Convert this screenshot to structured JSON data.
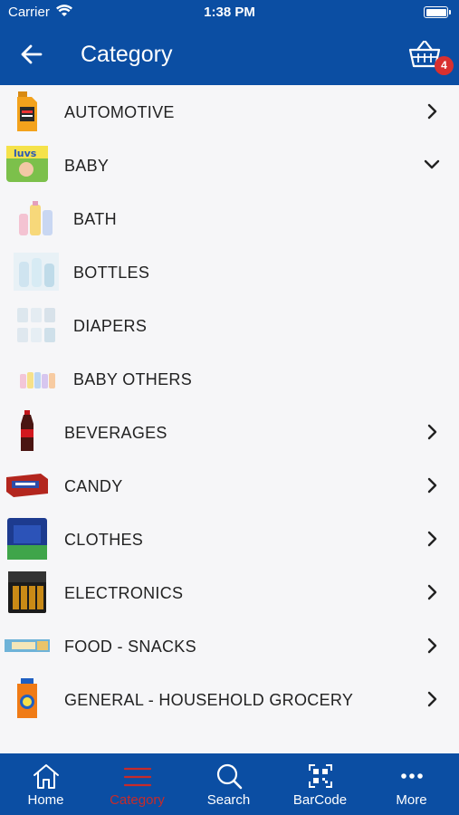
{
  "status": {
    "carrier": "Carrier",
    "time": "1:38 PM"
  },
  "header": {
    "title": "Category",
    "cart_count": "4"
  },
  "colors": {
    "brand": "#0b4ea3",
    "accent": "#c72b2a",
    "badge": "#d9302f",
    "background": "#f6f6f8"
  },
  "categories": [
    {
      "label": "AUTOMOTIVE",
      "chevron": "right"
    },
    {
      "label": "BABY",
      "chevron": "down"
    },
    {
      "label": "BATH",
      "chevron": ""
    },
    {
      "label": "BOTTLES",
      "chevron": ""
    },
    {
      "label": "DIAPERS",
      "chevron": ""
    },
    {
      "label": "BABY OTHERS",
      "chevron": ""
    },
    {
      "label": "BEVERAGES",
      "chevron": "right"
    },
    {
      "label": "CANDY",
      "chevron": "right"
    },
    {
      "label": "CLOTHES",
      "chevron": "right"
    },
    {
      "label": "ELECTRONICS",
      "chevron": "right"
    },
    {
      "label": "FOOD - SNACKS",
      "chevron": "right"
    },
    {
      "label": "GENERAL - HOUSEHOLD GROCERY",
      "chevron": "right"
    }
  ],
  "tabs": [
    {
      "label": "Home",
      "icon": "home-icon"
    },
    {
      "label": "Category",
      "icon": "menu-icon"
    },
    {
      "label": "Search",
      "icon": "search-icon"
    },
    {
      "label": "BarCode",
      "icon": "barcode-icon"
    },
    {
      "label": "More",
      "icon": "more-icon"
    }
  ]
}
